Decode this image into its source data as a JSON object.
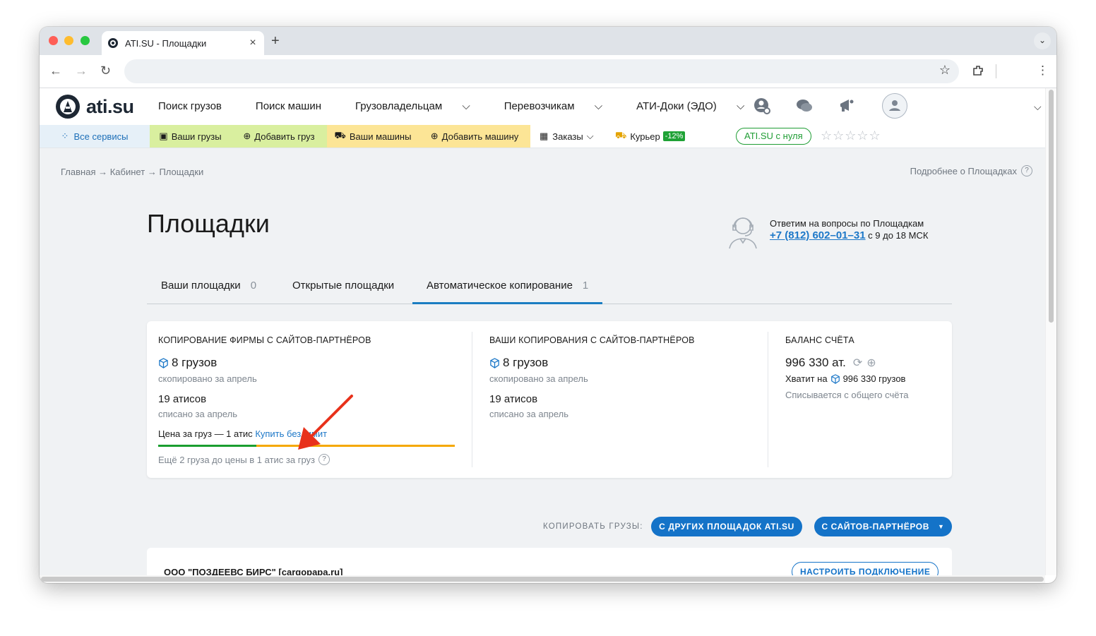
{
  "browser": {
    "tab_title": "ATI.SU - Площадки"
  },
  "header": {
    "logo_text": "ati.su",
    "nav": [
      {
        "label": "Поиск грузов",
        "dropdown": false
      },
      {
        "label": "Поиск машин",
        "dropdown": false
      },
      {
        "label": "Грузовладельцам",
        "dropdown": true
      },
      {
        "label": "Перевозчикам",
        "dropdown": true
      },
      {
        "label": "АТИ-Доки (ЭДО)",
        "dropdown": true
      }
    ]
  },
  "services_bar": {
    "all_services": "Все сервисы",
    "your_cargo": "Ваши грузы",
    "add_cargo": "Добавить груз",
    "your_trucks": "Ваши машины",
    "add_truck": "Добавить машину",
    "orders": "Заказы",
    "courier": "Курьер",
    "courier_badge": "-12%",
    "ati_from_zero": "ATI.SU с нуля",
    "rating_stars": 0,
    "colors": {
      "green_bg": "#d9ef9f",
      "yellow_bg": "#fce596",
      "all_bg": "#e6f0f8"
    }
  },
  "breadcrumb": {
    "items": [
      "Главная",
      "Кабинет",
      "Площадки"
    ],
    "separator": "→"
  },
  "more_link": "Подробнее о Площадках",
  "page": {
    "title": "Площадки",
    "support_text": "Ответим на вопросы по Площадкам",
    "support_phone": "+7 (812) 602–01–31",
    "support_hours": "с 9 до 18 МСК"
  },
  "tabs": [
    {
      "label": "Ваши площадки",
      "count": "0"
    },
    {
      "label": "Открытые площадки",
      "count": ""
    },
    {
      "label": "Автоматическое копирование",
      "count": "1",
      "active": true
    }
  ],
  "summary": {
    "firm_copy": {
      "caption": "Копирование фирмы с сайтов-партнёров",
      "cargo_count": "8 грузов",
      "cargo_sub": "скопировано за апрель",
      "atis": "19 атисов",
      "atis_sub": "списано за апрель",
      "price_text": "Цена за груз — 1 атис",
      "buy_link": "Купить безлимит",
      "progress_fraction": 0.33,
      "progress_note": "Ещё 2 груза до цены в 1 атис за груз"
    },
    "your_copies": {
      "caption": "Ваши копирования с сайтов-партнёров",
      "cargo_count": "8 грузов",
      "cargo_sub": "скопировано за апрель",
      "atis": "19 атисов",
      "atis_sub": "списано за апрель"
    },
    "balance": {
      "caption": "Баланс счёта",
      "amount": "996 330 ат.",
      "enough_prefix": "Хватит на",
      "enough_value": "996 330 грузов",
      "note": "Списывается с общего счёта"
    }
  },
  "copy_actions": {
    "label": "КОПИРОВАТЬ ГРУЗЫ:",
    "btn_other": "С ДРУГИХ ПЛОЩАДОК ATI.SU",
    "btn_partners": "С САЙТОВ-ПАРТНЁРОВ"
  },
  "connection": {
    "name": "ООО \"ПОЗДЕЕВС БИРС\" [cargopapa.ru]",
    "configure": "НАСТРОИТЬ ПОДКЛЮЧЕНИЕ"
  },
  "colors": {
    "accent_blue": "#1473c8",
    "progress_green": "#1a9e2f",
    "progress_orange": "#f5a800",
    "annotation_red": "#e8311b"
  }
}
